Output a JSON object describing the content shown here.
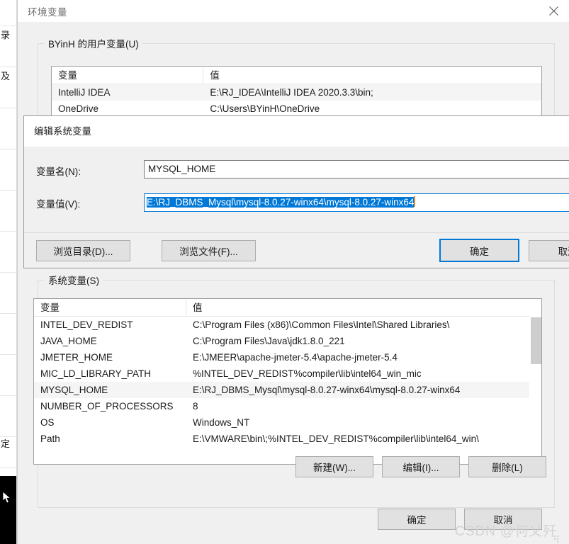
{
  "window": {
    "title": "环境变量",
    "close_icon": "close-icon"
  },
  "user_vars": {
    "legend": "BYinH 的用户变量(U)",
    "columns": [
      "变量",
      "值"
    ],
    "rows": [
      {
        "name": "IntelliJ IDEA",
        "value": "E:\\RJ_IDEA\\IntelliJ IDEA 2020.3.3\\bin;"
      },
      {
        "name": "OneDrive",
        "value": "C:\\Users\\BYinH\\OneDrive"
      }
    ]
  },
  "system_vars": {
    "legend": "系统变量(S)",
    "columns": [
      "变量",
      "值"
    ],
    "rows": [
      {
        "name": "INTEL_DEV_REDIST",
        "value": "C:\\Program Files (x86)\\Common Files\\Intel\\Shared Libraries\\"
      },
      {
        "name": "JAVA_HOME",
        "value": "C:\\Program Files\\Java\\jdk1.8.0_221"
      },
      {
        "name": "JMETER_HOME",
        "value": "E:\\JMEER\\apache-jmeter-5.4\\apache-jmeter-5.4"
      },
      {
        "name": "MIC_LD_LIBRARY_PATH",
        "value": "%INTEL_DEV_REDIST%compiler\\lib\\intel64_win_mic"
      },
      {
        "name": "MYSQL_HOME",
        "value": "E:\\RJ_DBMS_Mysql\\mysql-8.0.27-winx64\\mysql-8.0.27-winx64"
      },
      {
        "name": "NUMBER_OF_PROCESSORS",
        "value": "8"
      },
      {
        "name": "OS",
        "value": "Windows_NT"
      },
      {
        "name": "Path",
        "value": "E:\\VMWARE\\bin\\;%INTEL_DEV_REDIST%compiler\\lib\\intel64_win\\"
      }
    ],
    "selected_row_index": 4,
    "scroll_down_icon": "chevron-down-icon"
  },
  "system_buttons": {
    "new": "新建(W)...",
    "edit": "编辑(I)...",
    "delete": "删除(L)"
  },
  "main_buttons": {
    "ok": "确定",
    "cancel": "取消"
  },
  "edit_dialog": {
    "title": "编辑系统变量",
    "name_label": "变量名(N):",
    "name_value": "MYSQL_HOME",
    "name_placeholder": "",
    "value_label": "变量值(V):",
    "value_value": "E:\\RJ_DBMS_Mysql\\mysql-8.0.27-winx64\\mysql-8.0.27-winx64",
    "value_placeholder": "",
    "browse_dir": "浏览目录(D)...",
    "browse_file": "浏览文件(F)...",
    "ok": "确定",
    "cancel": "取消"
  },
  "watermark": {
    "text": "CSDN @何乂歼"
  },
  "colors": {
    "accent": "#0078d7",
    "selection": "#0078d7",
    "window_bg": "#f0f0f0",
    "caret": "#d98a3a"
  }
}
